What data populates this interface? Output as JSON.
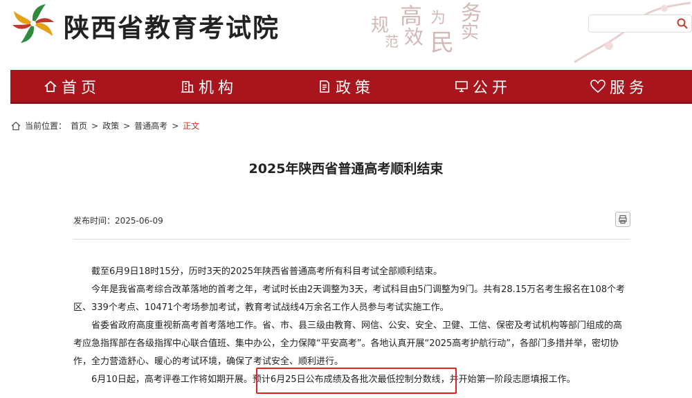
{
  "header": {
    "site_title": "陕西省教育考试院",
    "motto": [
      "规",
      "高",
      "范",
      "为",
      "效",
      "民",
      "务",
      "实"
    ],
    "search": {
      "placeholder": ""
    }
  },
  "nav": {
    "items": [
      {
        "label": "首页",
        "icon": "home-icon"
      },
      {
        "label": "机构",
        "icon": "building-icon"
      },
      {
        "label": "政策",
        "icon": "document-icon"
      },
      {
        "label": "公开",
        "icon": "monitor-icon"
      },
      {
        "label": "服务",
        "icon": "heart-hand-icon"
      }
    ]
  },
  "breadcrumb": {
    "prefix": "当前位置：",
    "items": [
      "首页",
      "政策",
      "普通高考"
    ],
    "separator": ">",
    "current": "正文"
  },
  "article": {
    "title": "2025年陕西省普通高考顺利结束",
    "publish_label": "发布时间：",
    "publish_date": "2025-06-09",
    "paragraphs": [
      "截至6月9日18时15分，历时3天的2025年陕西省普通高考所有科目考试全部顺利结束。",
      "今年是我省高考综合改革落地的首考之年，考试时长由2天调整为3天，考试科目由5门调整为9门。共有28.15万名考生报名在108个考区、339个考点、10471个考场参加考试，教育考试战线4万余名工作人员参与考试实施工作。",
      "省委省政府高度重视新高考首考落地工作。省、市、县三级由教育、网信、公安、安全、卫健、工信、保密及考试机构等部门组成的高考应急指挥部在各级指挥中心联合值班、集中办公，全力保障“平安高考”。各地认真开展“2025高考护航行动”，各部门多措并举，密切协作，全力营造舒心、暖心的考试环境，确保了考试安全、顺利进行。",
      "6月10日起，高考评卷工作将如期开展。预计6月25日公布成绩及各批次最低控制分数线，并开始第一阶段志愿填报工作。"
    ]
  },
  "colors": {
    "nav_bg": "#a8151c",
    "highlight": "#e0211f",
    "breadcrumb_current": "#c0392b"
  }
}
